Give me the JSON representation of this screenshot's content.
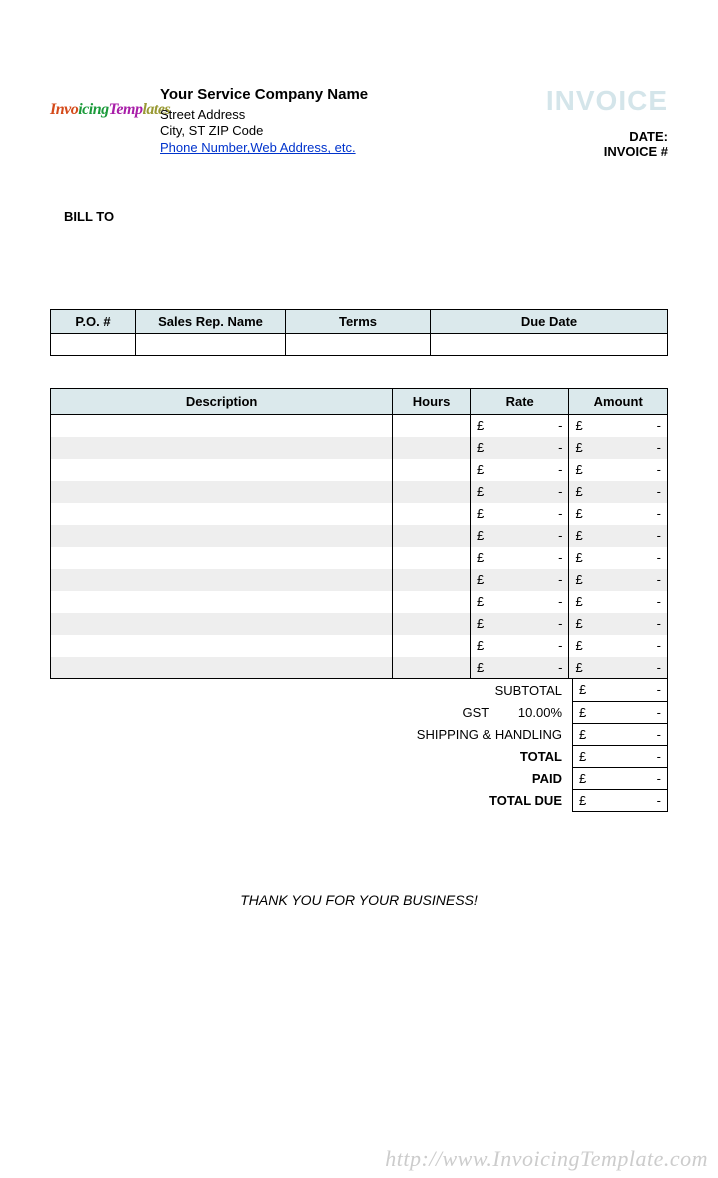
{
  "logo_text": "InvoicingTemplates",
  "company": {
    "name": "Your Service Company Name",
    "street": "Street Address",
    "city_line": "City, ST  ZIP Code",
    "contact_link": "Phone Number,Web Address, etc."
  },
  "title": "INVOICE",
  "meta": {
    "date_label": "DATE:",
    "invoice_no_label": "INVOICE #"
  },
  "bill_to_label": "BILL TO",
  "info_headers": {
    "po": "P.O. #",
    "rep": "Sales Rep. Name",
    "terms": "Terms",
    "due": "Due Date"
  },
  "info_values": {
    "po": "",
    "rep": "",
    "terms": "",
    "due": ""
  },
  "item_headers": {
    "desc": "Description",
    "hours": "Hours",
    "rate": "Rate",
    "amount": "Amount"
  },
  "currency": "£",
  "dash": "-",
  "items": [
    {
      "desc": "",
      "hours": "",
      "rate": "-",
      "amount": "-"
    },
    {
      "desc": "",
      "hours": "",
      "rate": "-",
      "amount": "-"
    },
    {
      "desc": "",
      "hours": "",
      "rate": "-",
      "amount": "-"
    },
    {
      "desc": "",
      "hours": "",
      "rate": "-",
      "amount": "-"
    },
    {
      "desc": "",
      "hours": "",
      "rate": "-",
      "amount": "-"
    },
    {
      "desc": "",
      "hours": "",
      "rate": "-",
      "amount": "-"
    },
    {
      "desc": "",
      "hours": "",
      "rate": "-",
      "amount": "-"
    },
    {
      "desc": "",
      "hours": "",
      "rate": "-",
      "amount": "-"
    },
    {
      "desc": "",
      "hours": "",
      "rate": "-",
      "amount": "-"
    },
    {
      "desc": "",
      "hours": "",
      "rate": "-",
      "amount": "-"
    },
    {
      "desc": "",
      "hours": "",
      "rate": "-",
      "amount": "-"
    },
    {
      "desc": "",
      "hours": "",
      "rate": "-",
      "amount": "-"
    }
  ],
  "totals": {
    "subtotal_label": "SUBTOTAL",
    "gst_label": "GST",
    "gst_rate": "10.00%",
    "shipping_label": "SHIPPING & HANDLING",
    "total_label": "TOTAL",
    "paid_label": "PAID",
    "due_label": "TOTAL DUE",
    "subtotal": "-",
    "gst": "-",
    "shipping": "-",
    "total": "-",
    "paid": "-",
    "due": "-"
  },
  "thank_you": "THANK YOU FOR YOUR BUSINESS!",
  "watermark": "http://www.InvoicingTemplate.com"
}
